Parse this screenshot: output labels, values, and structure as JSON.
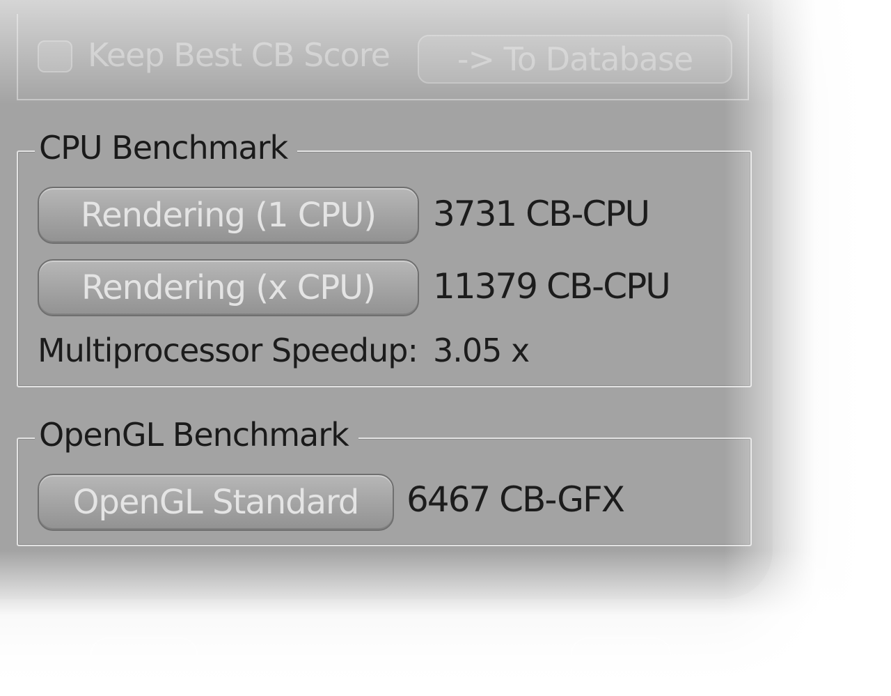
{
  "top_section": {
    "keep_best_label": "Keep Best CB Score",
    "to_database_label": "-> To Database"
  },
  "cpu_benchmark": {
    "title": "CPU Benchmark",
    "single_button_label": "Rendering (1 CPU)",
    "single_score": "3731 CB-CPU",
    "multi_button_label": "Rendering (x CPU)",
    "multi_score": "11379 CB-CPU",
    "speedup_label": "Multiprocessor Speedup:",
    "speedup_value": "3.05 x"
  },
  "opengl_benchmark": {
    "title": "OpenGL Benchmark",
    "button_label": "OpenGL Standard",
    "score": "6467 CB-GFX"
  },
  "colors": {
    "panel_background": "#a3a3a3",
    "button_text": "#e4e4e4",
    "text": "#1c1c1c"
  },
  "icons": {
    "keep_best_checkbox": "checkbox-unchecked-icon"
  }
}
